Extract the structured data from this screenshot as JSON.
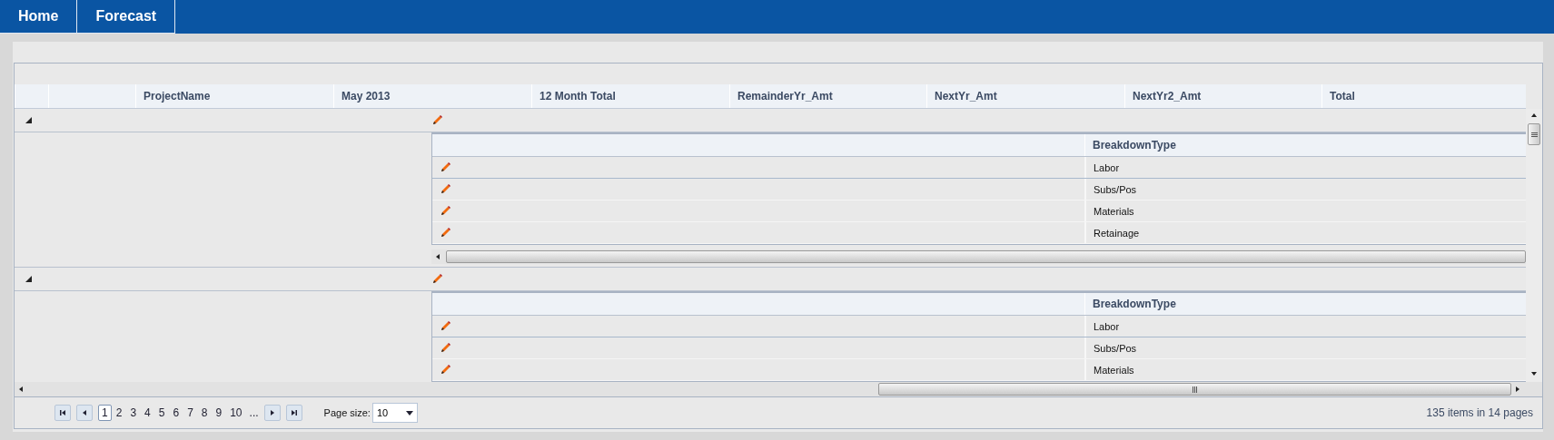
{
  "nav": {
    "tabs": [
      {
        "label": "Home"
      },
      {
        "label": "Forecast"
      }
    ]
  },
  "grid": {
    "columns": [
      "ProjectName",
      "May 2013",
      "12 Month Total",
      "RemainderYr_Amt",
      "NextYr_Amt",
      "NextYr2_Amt",
      "Total"
    ],
    "groups": [
      {
        "expanded": true,
        "detail": {
          "column": "BreakdownType",
          "rows": [
            "Labor",
            "Subs/Pos",
            "Materials",
            "Retainage"
          ]
        }
      },
      {
        "expanded": true,
        "detail": {
          "column": "BreakdownType",
          "rows": [
            "Labor",
            "Subs/Pos",
            "Materials"
          ]
        }
      }
    ]
  },
  "pager": {
    "pages": [
      {
        "label": "1",
        "selected": true
      },
      {
        "label": "2",
        "selected": false
      },
      {
        "label": "3",
        "selected": false
      },
      {
        "label": "4",
        "selected": false
      },
      {
        "label": "5",
        "selected": false
      },
      {
        "label": "6",
        "selected": false
      },
      {
        "label": "7",
        "selected": false
      },
      {
        "label": "8",
        "selected": false
      },
      {
        "label": "9",
        "selected": false
      },
      {
        "label": "10",
        "selected": false
      }
    ],
    "more": "...",
    "page_size_label": "Page size:",
    "page_size": "10",
    "summary": "135 items in 14 pages"
  }
}
